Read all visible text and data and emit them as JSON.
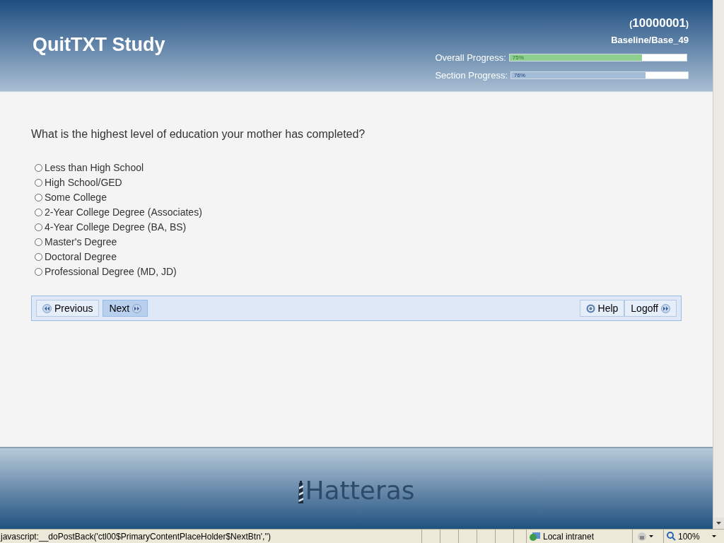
{
  "header": {
    "title": "QuitTXT Study",
    "participant_id": "10000001",
    "id_open": "(",
    "id_close": ")",
    "location": "Baseline/Base_49",
    "progress": [
      {
        "label": "Overall Progress:",
        "level": 0.75,
        "reading": "75%",
        "color": "#8fcf8f"
      },
      {
        "label": "Section Progress:",
        "level": 0.76,
        "reading": "76%",
        "color": "#a3bcd8"
      }
    ]
  },
  "question": {
    "text": "What is the highest level of education your mother has completed?",
    "options": [
      {
        "label": "Less than High School",
        "selected": false
      },
      {
        "label": "High School/GED",
        "selected": false
      },
      {
        "label": "Some College",
        "selected": false
      },
      {
        "label": "2-Year College Degree (Associates)",
        "selected": false
      },
      {
        "label": "4-Year College Degree (BA, BS)",
        "selected": false
      },
      {
        "label": "Master's Degree",
        "selected": false
      },
      {
        "label": "Doctoral Degree",
        "selected": false
      },
      {
        "label": "Professional Degree (MD, JD)",
        "selected": false
      }
    ]
  },
  "nav_left": [
    {
      "label": "Previous",
      "kind": "previous",
      "hovered": false
    },
    {
      "label": "Next",
      "kind": "next",
      "hovered": true
    }
  ],
  "nav_right": [
    {
      "label": "Help",
      "kind": "help",
      "hovered": false
    },
    {
      "label": "Logoff",
      "kind": "next",
      "hovered": false
    }
  ],
  "footer": {
    "logo_text": "Hatteras"
  },
  "status_bar": {
    "text": "javascript:__doPostBack('ctl00$PrimaryContentPlaceHolder$NextBtn','')",
    "zone": "Local intranet",
    "zoom": "100%"
  }
}
